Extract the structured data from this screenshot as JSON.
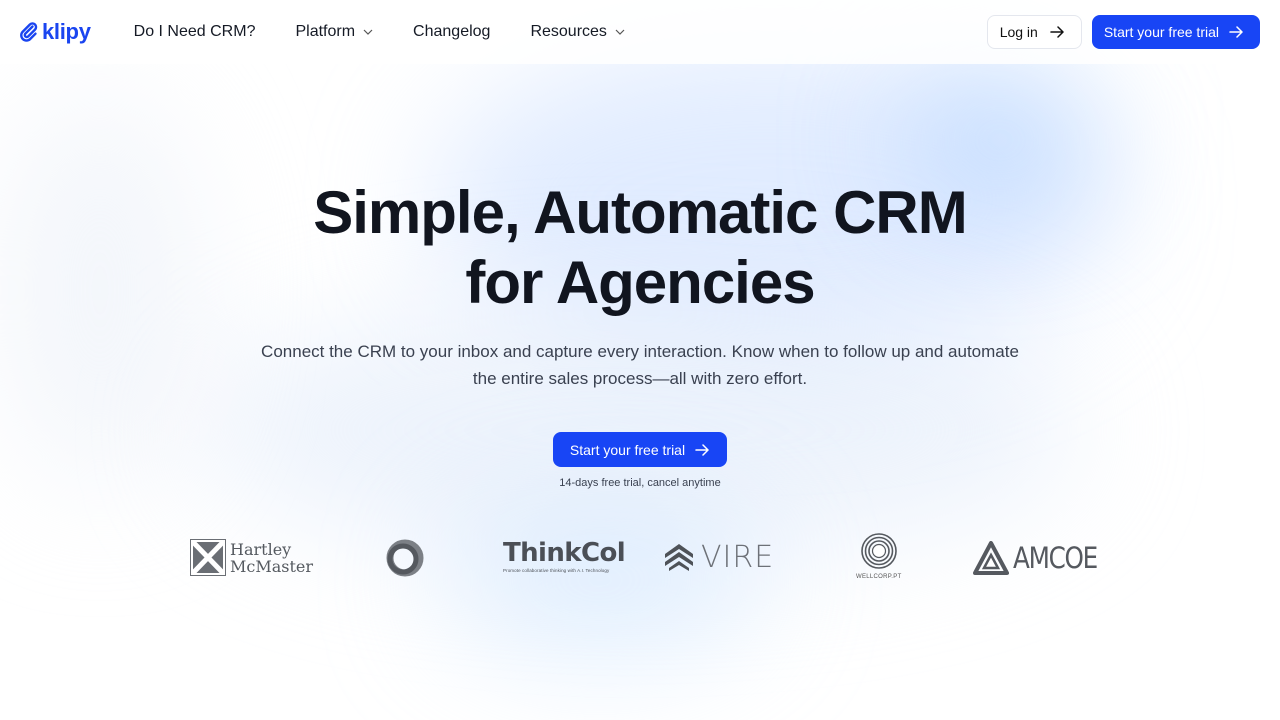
{
  "brand": {
    "name": "klipy",
    "accent_color": "#1845f5"
  },
  "header": {
    "nav": [
      {
        "label": "Do I Need CRM?",
        "has_dropdown": false
      },
      {
        "label": "Platform",
        "has_dropdown": true
      },
      {
        "label": "Changelog",
        "has_dropdown": false
      },
      {
        "label": "Resources",
        "has_dropdown": true
      }
    ],
    "login_label": "Log in",
    "cta_label": "Start your free trial"
  },
  "hero": {
    "title_line1": "Simple, Automatic CRM",
    "title_line2": "for Agencies",
    "subtitle": "Connect the CRM to your inbox and capture every interaction. Know when to follow up and automate the entire sales process—all with zero effort.",
    "cta_label": "Start your free trial",
    "note": "14-days free trial, cancel anytime"
  },
  "logos": {
    "hartley_line1": "Hartley",
    "hartley_line2": "McMaster",
    "thinkcol_name": "ThinkCol",
    "thinkcol_tagline": "Promote collaborative thinking with A.I. Technology",
    "vire": "VIRE",
    "wellcorp": "WELLCORP.PT",
    "amcoe": "AMCOE"
  }
}
